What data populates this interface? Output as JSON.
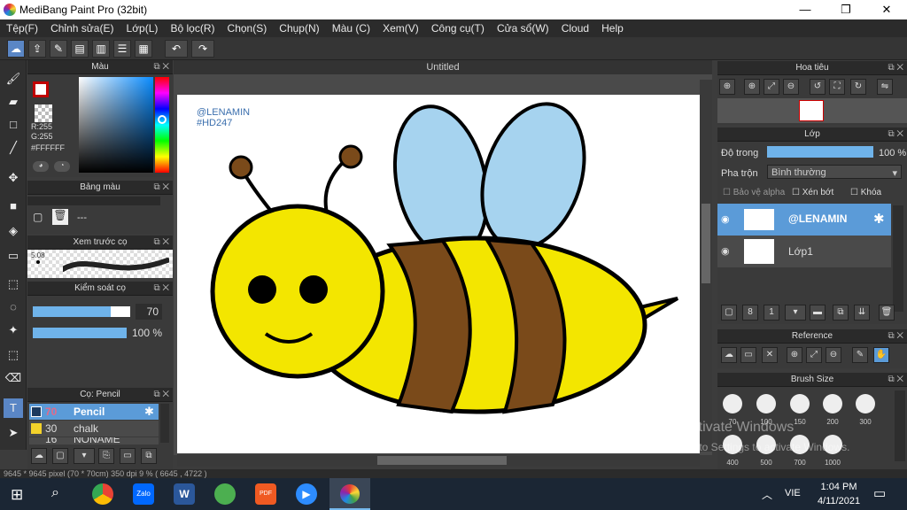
{
  "window": {
    "title": "MediBang Paint Pro (32bit)",
    "minimize": "—",
    "maximize": "❐",
    "close": "✕"
  },
  "menu": [
    "Tệp(F)",
    "Chỉnh sửa(E)",
    "Lớp(L)",
    "Bộ lọc(R)",
    "Chọn(S)",
    "Chụp(N)",
    "Màu (C)",
    "Xem(V)",
    "Công cụ(T)",
    "Cửa sổ(W)",
    "Cloud",
    "Help"
  ],
  "document": {
    "tab_title": "Untitled",
    "watermark_line1": "@LENAMIN",
    "watermark_line2": "#HD247"
  },
  "color_panel": {
    "title": "Màu",
    "r": "R:255",
    "g": "G:255",
    "hex": "#FFFFFF",
    "fg": "#c00000",
    "bg": "#7a3b10"
  },
  "palette_panel": {
    "title": "Bảng màu",
    "dash": "---"
  },
  "brush_preview": {
    "title": "Xem trước cọ",
    "size": "5.08"
  },
  "brush_control": {
    "title": "Kiểm soát cọ",
    "size_value": "70",
    "opacity_value": "100 %",
    "size_fill": 0.8,
    "opacity_fill": 1.0
  },
  "brush_list": {
    "title": "Cọ: Pencil",
    "items": [
      {
        "size": "70",
        "name": "Pencil",
        "color": "#1c3a5f"
      },
      {
        "size": "30",
        "name": "chalk",
        "color": "#f4d22a"
      },
      {
        "size": "16",
        "name": "NONAME",
        "color": "#000000"
      }
    ]
  },
  "navigator": {
    "title": "Hoa tiêu"
  },
  "layer_panel": {
    "title": "Lớp",
    "opacity_label": "Độ trong",
    "opacity_value": "100 %",
    "opacity_fill": 1.0,
    "blend_label": "Pha trộn",
    "blend_value": "Bình thường",
    "protect_alpha": "Bảo vệ alpha",
    "clip": "Xén bớt",
    "lock": "Khóa",
    "layers": [
      {
        "name": "@LENAMIN",
        "selected": true
      },
      {
        "name": "Lớp1",
        "selected": false
      }
    ]
  },
  "reference_panel": {
    "title": "Reference"
  },
  "brush_size_panel": {
    "title": "Brush Size",
    "sizes": [
      "70",
      "100",
      "150",
      "200",
      "300",
      "400",
      "500",
      "700",
      "1000"
    ]
  },
  "status": {
    "text": "9645 * 9645 pixel   (70 * 70cm)   350 dpi   9 %   ( 6645 , 4722 )"
  },
  "watermark_os": {
    "line1": "Activate Windows",
    "line2": "Go to Settings to activate Windows."
  },
  "taskbar": {
    "lang": "VIE",
    "time": "1:04 PM",
    "date": "4/11/2021",
    "zalo": "Zalo",
    "word": "W",
    "pdf": "PDF"
  }
}
